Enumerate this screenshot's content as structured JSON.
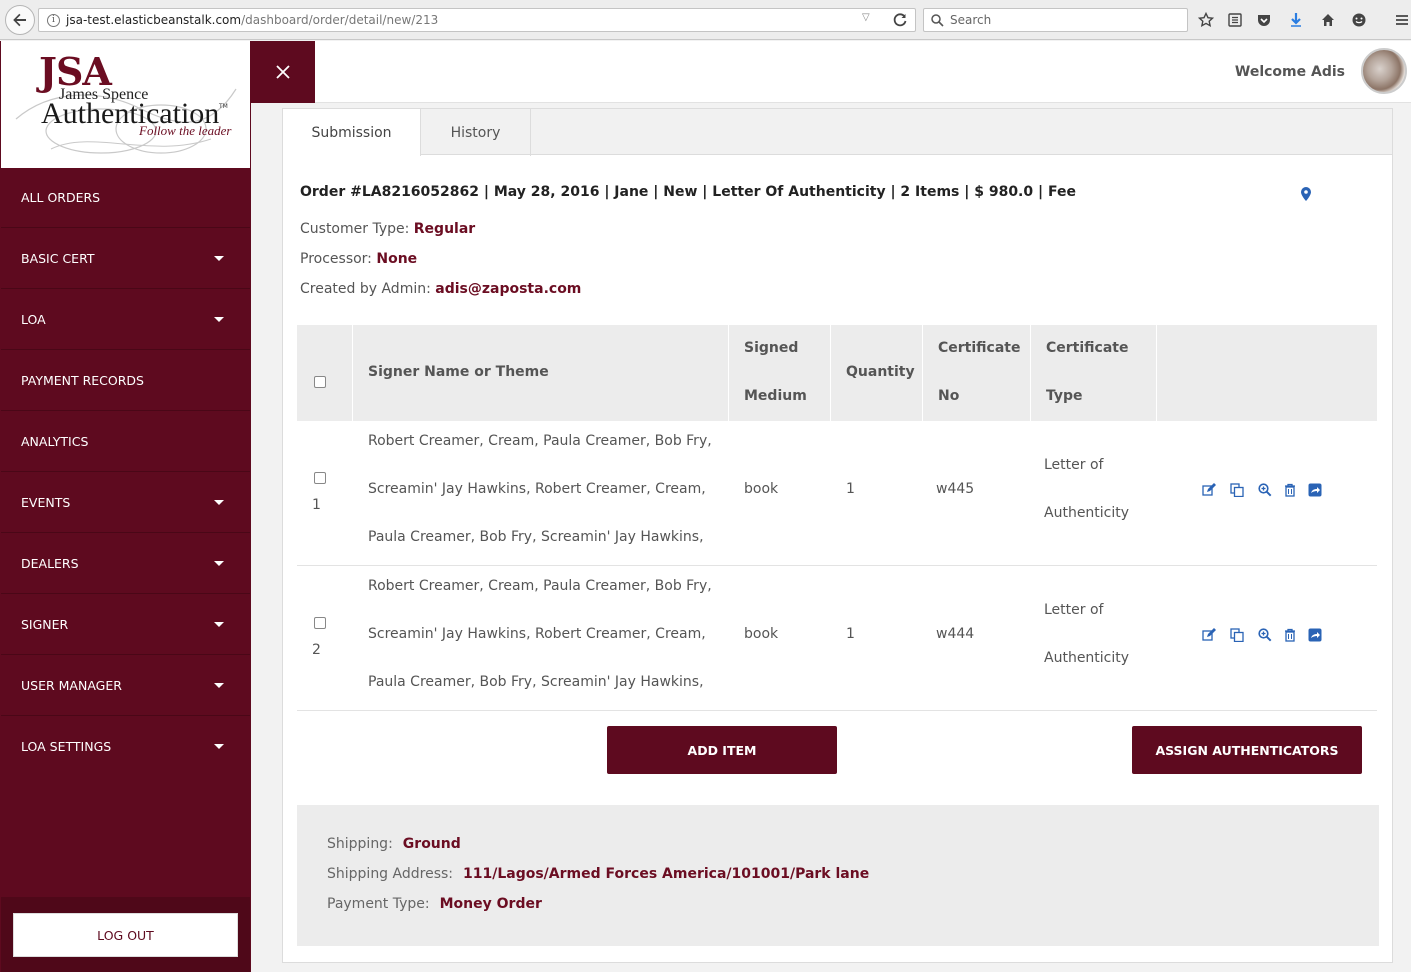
{
  "browser": {
    "url_host": "jsa-test.elasticbeanstalk.com",
    "url_path": "/dashboard/order/detail/new/213",
    "search_placeholder": "Search"
  },
  "logo": {
    "jsa": "JSA",
    "sub": "James Spence",
    "main": "Authentication",
    "tm": "TM",
    "tagline": "Follow the leader"
  },
  "sidebar": {
    "items": [
      {
        "label": "ALL ORDERS",
        "has_caret": false
      },
      {
        "label": "BASIC CERT",
        "has_caret": true
      },
      {
        "label": "LOA",
        "has_caret": true
      },
      {
        "label": "PAYMENT RECORDS",
        "has_caret": false
      },
      {
        "label": "ANALYTICS",
        "has_caret": false
      },
      {
        "label": "EVENTS",
        "has_caret": true
      },
      {
        "label": "DEALERS",
        "has_caret": true
      },
      {
        "label": "SIGNER",
        "has_caret": true
      },
      {
        "label": "USER MANAGER",
        "has_caret": true
      },
      {
        "label": "LOA SETTINGS",
        "has_caret": true
      }
    ],
    "logout_label": "LOG OUT"
  },
  "header": {
    "welcome": "Welcome Adis"
  },
  "tabs": [
    {
      "label": "Submission",
      "active": true
    },
    {
      "label": "History",
      "active": false
    }
  ],
  "order": {
    "summary": "Order #LA8216052862 | May 28, 2016 | Jane | New | Letter Of Authenticity | 2 Items | $ 980.0 | Fee",
    "customer_type_label": "Customer Type:",
    "customer_type": "Regular",
    "processor_label": "Processor:",
    "processor": "None",
    "created_by_label": "Created by Admin:",
    "created_by": "adis@zaposta.com"
  },
  "table": {
    "headers": {
      "signer": "Signer Name or Theme",
      "medium_1": "Signed",
      "medium_2": "Medium",
      "quantity": "Quantity",
      "cert_no_1": "Certificate",
      "cert_no_2": "No",
      "cert_type_1": "Certificate",
      "cert_type_2": "Type"
    },
    "rows": [
      {
        "num": "1",
        "signer_1": "Robert Creamer, Cream, Paula Creamer, Bob Fry,",
        "signer_2": "Screamin' Jay Hawkins, Robert Creamer, Cream,",
        "signer_3": "Paula Creamer, Bob Fry, Screamin' Jay Hawkins,",
        "medium": "book",
        "quantity": "1",
        "cert_no": "w445",
        "cert_type_1": "Letter of",
        "cert_type_2": "Authenticity"
      },
      {
        "num": "2",
        "signer_1": "Robert Creamer, Cream, Paula Creamer, Bob Fry,",
        "signer_2": "Screamin' Jay Hawkins, Robert Creamer, Cream,",
        "signer_3": "Paula Creamer, Bob Fry, Screamin' Jay Hawkins,",
        "medium": "book",
        "quantity": "1",
        "cert_no": "w444",
        "cert_type_1": "Letter of",
        "cert_type_2": "Authenticity"
      }
    ],
    "row_action_icons": [
      "edit-icon",
      "copy-icon",
      "zoom-icon",
      "trash-icon",
      "share-icon"
    ]
  },
  "buttons": {
    "add_item": "ADD ITEM",
    "assign_authenticators": "ASSIGN AUTHENTICATORS"
  },
  "shipping": {
    "shipping_label": "Shipping:",
    "shipping": "Ground",
    "address_label": "Shipping Address:",
    "address": "111/Lagos/Armed Forces America/101001/Park lane",
    "payment_label": "Payment Type:",
    "payment": "Money Order"
  },
  "colors": {
    "brand": "#5e0a1f",
    "accent_text": "#6b0d22",
    "icon_blue": "#2a63b5"
  }
}
